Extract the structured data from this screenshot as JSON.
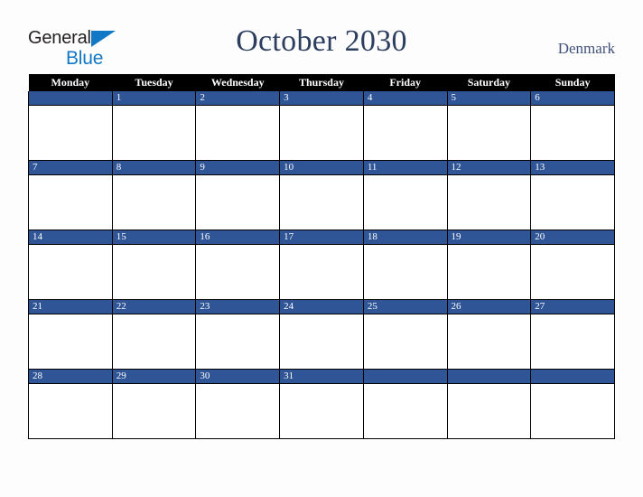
{
  "brand": {
    "name_part1": "General",
    "name_part2": "Blue",
    "triangle_icon": "triangle-right-icon",
    "color_dark": "#231f20",
    "color_blue": "#1277c4"
  },
  "header": {
    "title": "October 2030",
    "month": "October",
    "year": "2030",
    "region": "Denmark",
    "title_color": "#2c3e60",
    "region_color": "#41527a"
  },
  "calendar": {
    "header_background": "#000000",
    "header_text_color": "#ffffff",
    "date_strip_color": "#2f5597",
    "date_text_color": "#ffffff",
    "cell_background": "#ffffff",
    "border_color": "#000000",
    "weekdays": [
      "Monday",
      "Tuesday",
      "Wednesday",
      "Thursday",
      "Friday",
      "Saturday",
      "Sunday"
    ],
    "weeks": [
      [
        {
          "date": ""
        },
        {
          "date": "1"
        },
        {
          "date": "2"
        },
        {
          "date": "3"
        },
        {
          "date": "4"
        },
        {
          "date": "5"
        },
        {
          "date": "6"
        }
      ],
      [
        {
          "date": "7"
        },
        {
          "date": "8"
        },
        {
          "date": "9"
        },
        {
          "date": "10"
        },
        {
          "date": "11"
        },
        {
          "date": "12"
        },
        {
          "date": "13"
        }
      ],
      [
        {
          "date": "14"
        },
        {
          "date": "15"
        },
        {
          "date": "16"
        },
        {
          "date": "17"
        },
        {
          "date": "18"
        },
        {
          "date": "19"
        },
        {
          "date": "20"
        }
      ],
      [
        {
          "date": "21"
        },
        {
          "date": "22"
        },
        {
          "date": "23"
        },
        {
          "date": "24"
        },
        {
          "date": "25"
        },
        {
          "date": "26"
        },
        {
          "date": "27"
        }
      ],
      [
        {
          "date": "28"
        },
        {
          "date": "29"
        },
        {
          "date": "30"
        },
        {
          "date": "31"
        },
        {
          "date": ""
        },
        {
          "date": ""
        },
        {
          "date": ""
        }
      ]
    ]
  }
}
